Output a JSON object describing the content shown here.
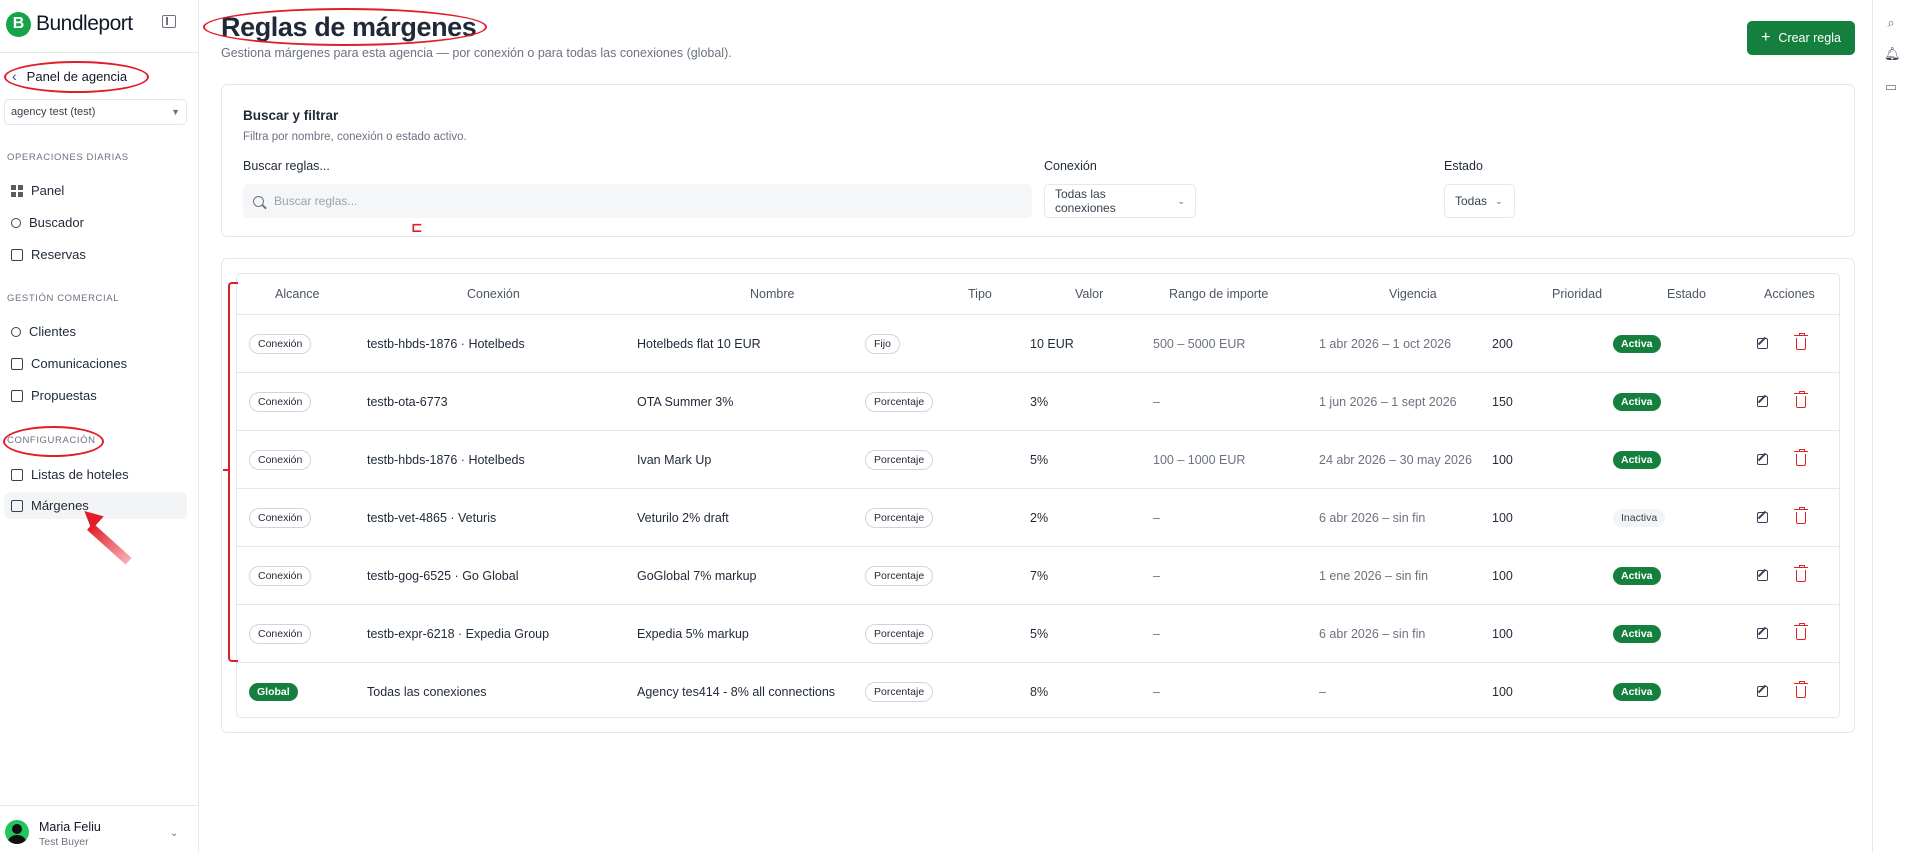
{
  "brand": {
    "name": "Bundleport",
    "logo_letter": "B",
    "color": "#16a34a"
  },
  "sidebar": {
    "back_label": "Panel de agencia",
    "agency_select": "agency test (test)",
    "sections": [
      {
        "title": "OPERACIONES DIARIAS",
        "items": [
          {
            "label": "Panel",
            "icon": "grid-icon"
          },
          {
            "label": "Buscador",
            "icon": "search-icon"
          },
          {
            "label": "Reservas",
            "icon": "calendar-icon"
          }
        ]
      },
      {
        "title": "GESTIÓN COMERCIAL",
        "items": [
          {
            "label": "Clientes",
            "icon": "users-icon"
          },
          {
            "label": "Comunicaciones",
            "icon": "message-icon"
          },
          {
            "label": "Propuestas",
            "icon": "document-icon"
          }
        ]
      },
      {
        "title": "CONFIGURACIÓN",
        "items": [
          {
            "label": "Listas de hoteles",
            "icon": "bookmark-icon"
          },
          {
            "label": "Márgenes",
            "icon": "receipt-icon",
            "active": true
          }
        ]
      }
    ],
    "user": {
      "name": "Maria Feliu",
      "role": "Test Buyer"
    }
  },
  "header": {
    "title": "Reglas de márgenes",
    "subtitle": "Gestiona márgenes para esta agencia — por conexión o para todas las conexiones (global).",
    "create_button": "Crear regla"
  },
  "filters": {
    "title": "Buscar y filtrar",
    "subtitle": "Filtra por nombre, conexión o estado activo.",
    "search_label": "Buscar reglas...",
    "search_placeholder": "Buscar reglas...",
    "connection_label": "Conexión",
    "connection_value": "Todas las conexiones",
    "status_label": "Estado",
    "status_value": "Todas"
  },
  "table": {
    "columns": [
      "Alcance",
      "Conexión",
      "Nombre",
      "Tipo",
      "Valor",
      "Rango de importe",
      "Vigencia",
      "Prioridad",
      "Estado",
      "Acciones"
    ],
    "rows": [
      {
        "scope": "Conexión",
        "connection": "testb-hbds-1876 · Hotelbeds",
        "name": "Hotelbeds flat 10 EUR",
        "type": "Fijo",
        "value": "10 EUR",
        "range": "500 – 5000 EUR",
        "validity": "1 abr 2026 – 1 oct 2026",
        "priority": "200",
        "status": "Activa"
      },
      {
        "scope": "Conexión",
        "connection": "testb-ota-6773",
        "name": "OTA Summer 3%",
        "type": "Porcentaje",
        "value": "3%",
        "range": "–",
        "validity": "1 jun 2026 – 1 sept 2026",
        "priority": "150",
        "status": "Activa"
      },
      {
        "scope": "Conexión",
        "connection": "testb-hbds-1876 · Hotelbeds",
        "name": "Ivan Mark Up",
        "type": "Porcentaje",
        "value": "5%",
        "range": "100 – 1000 EUR",
        "validity": "24 abr 2026 – 30 may 2026",
        "priority": "100",
        "status": "Activa"
      },
      {
        "scope": "Conexión",
        "connection": "testb-vet-4865 · Veturis",
        "name": "Veturilo 2% draft",
        "type": "Porcentaje",
        "value": "2%",
        "range": "–",
        "validity": "6 abr 2026 – sin fin",
        "priority": "100",
        "status": "Inactiva"
      },
      {
        "scope": "Conexión",
        "connection": "testb-gog-6525 · Go Global",
        "name": "GoGlobal 7% markup",
        "type": "Porcentaje",
        "value": "7%",
        "range": "–",
        "validity": "1 ene 2026 – sin fin",
        "priority": "100",
        "status": "Activa"
      },
      {
        "scope": "Conexión",
        "connection": "testb-expr-6218 · Expedia Group",
        "name": "Expedia 5% markup",
        "type": "Porcentaje",
        "value": "5%",
        "range": "–",
        "validity": "6 abr 2026 – sin fin",
        "priority": "100",
        "status": "Activa"
      },
      {
        "scope": "Global",
        "connection": "Todas las conexiones",
        "name": "Agency tes414 - 8% all connections",
        "type": "Porcentaje",
        "value": "8%",
        "range": "–",
        "validity": "–",
        "priority": "100",
        "status": "Activa"
      }
    ]
  },
  "colors": {
    "accent": "#15803d",
    "danger": "#dc2626",
    "annotation": "#e11d2a"
  },
  "right_rail": {
    "icons": [
      "search-icon",
      "bell-icon",
      "chat-icon"
    ]
  }
}
